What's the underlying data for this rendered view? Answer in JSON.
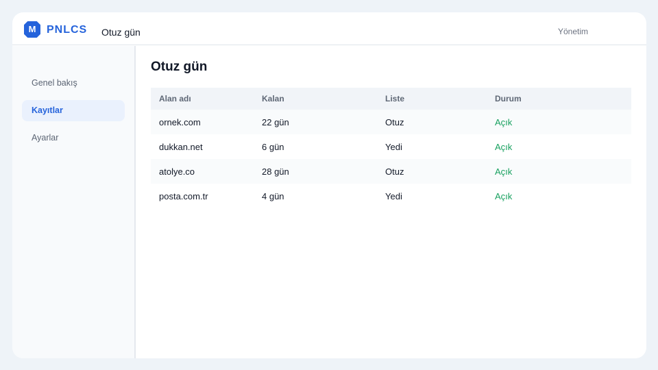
{
  "brand": {
    "logo_letter": "M",
    "name": "PNLCS",
    "color": "#2563db"
  },
  "topbar": {
    "title": "Otuz gün",
    "admin_label": "Yönetim"
  },
  "sidebar": {
    "items": [
      {
        "label": "Genel bakış",
        "active": false
      },
      {
        "label": "Kayıtlar",
        "active": true
      },
      {
        "label": "Ayarlar",
        "active": false
      }
    ]
  },
  "main": {
    "title": "Otuz gün",
    "table": {
      "columns": [
        "Alan adı",
        "Kalan",
        "Liste",
        "Durum"
      ],
      "rows": [
        [
          "ornek.com",
          "22 gün",
          "Otuz",
          "Açık"
        ],
        [
          "dukkan.net",
          "6 gün",
          "Yedi",
          "Açık"
        ],
        [
          "atolye.co",
          "28 gün",
          "Otuz",
          "Açık"
        ],
        [
          "posta.com.tr",
          "4 gün",
          "Yedi",
          "Açık"
        ]
      ]
    }
  },
  "colors": {
    "accent": "#2563db",
    "status_open": "#16a05e",
    "background": "#eef3f8"
  }
}
